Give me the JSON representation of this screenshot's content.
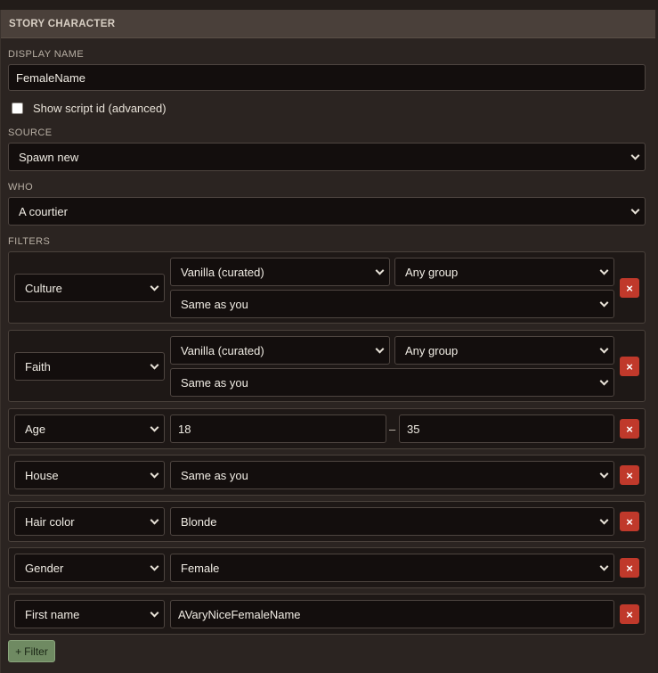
{
  "panel": {
    "title": "STORY CHARACTER"
  },
  "display_name": {
    "label": "DISPLAY NAME",
    "value": "FemaleName"
  },
  "show_script_id": {
    "label": "Show script id (advanced)",
    "checked": false
  },
  "source": {
    "label": "SOURCE",
    "value": "Spawn new"
  },
  "who": {
    "label": "WHO",
    "value": "A courtier"
  },
  "filters": {
    "label": "FILTERS",
    "culture": {
      "type": "Culture",
      "preset": "Vanilla (curated)",
      "group": "Any group",
      "value": "Same as you"
    },
    "faith": {
      "type": "Faith",
      "preset": "Vanilla (curated)",
      "group": "Any group",
      "value": "Same as you"
    },
    "age": {
      "type": "Age",
      "min": "18",
      "separator": "–",
      "max": "35"
    },
    "house": {
      "type": "House",
      "value": "Same as you"
    },
    "hair": {
      "type": "Hair color",
      "value": "Blonde"
    },
    "gender": {
      "type": "Gender",
      "value": "Female"
    },
    "first_name": {
      "type": "First name",
      "value": "AVaryNiceFemaleName"
    },
    "remove_glyph": "×",
    "add_label": "Filter",
    "add_glyph": "+"
  },
  "colors": {
    "remove_button": "#c0392b",
    "add_button": "#6f8a62",
    "field_bg": "#130e0d"
  }
}
